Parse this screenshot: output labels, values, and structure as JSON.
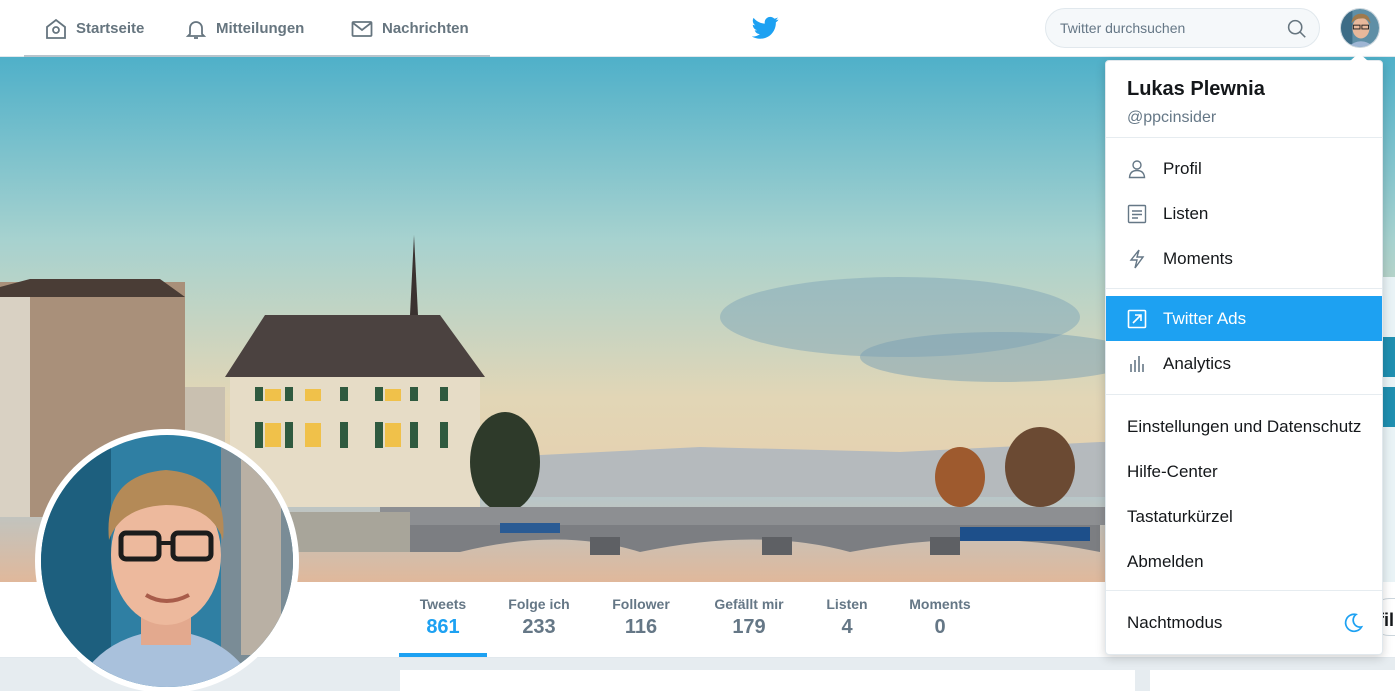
{
  "nav": {
    "home_label": "Startseite",
    "notifications_label": "Mitteilungen",
    "messages_label": "Nachrichten"
  },
  "search": {
    "placeholder": "Twitter durchsuchen"
  },
  "colors": {
    "brand": "#1da1f2",
    "text": "#14171a",
    "muted": "#657786"
  },
  "profile_stats": [
    {
      "label": "Tweets",
      "value": "861"
    },
    {
      "label": "Folge ich",
      "value": "233"
    },
    {
      "label": "Follower",
      "value": "116"
    },
    {
      "label": "Gefällt mir",
      "value": "179"
    },
    {
      "label": "Listen",
      "value": "4"
    },
    {
      "label": "Moments",
      "value": "0"
    }
  ],
  "edge_button_fragment": "fil",
  "dropdown": {
    "name": "Lukas Plewnia",
    "handle": "@ppcinsider",
    "items": [
      {
        "label": "Profil",
        "icon": "user-icon"
      },
      {
        "label": "Listen",
        "icon": "list-icon"
      },
      {
        "label": "Moments",
        "icon": "lightning-icon"
      },
      {
        "label": "Twitter Ads",
        "icon": "external-arrow-icon"
      },
      {
        "label": "Analytics",
        "icon": "bar-chart-icon"
      },
      {
        "label": "Einstellungen und Datenschutz"
      },
      {
        "label": "Hilfe-Center"
      },
      {
        "label": "Tastaturkürzel"
      },
      {
        "label": "Abmelden"
      }
    ],
    "night_mode_label": "Nachtmodus"
  }
}
